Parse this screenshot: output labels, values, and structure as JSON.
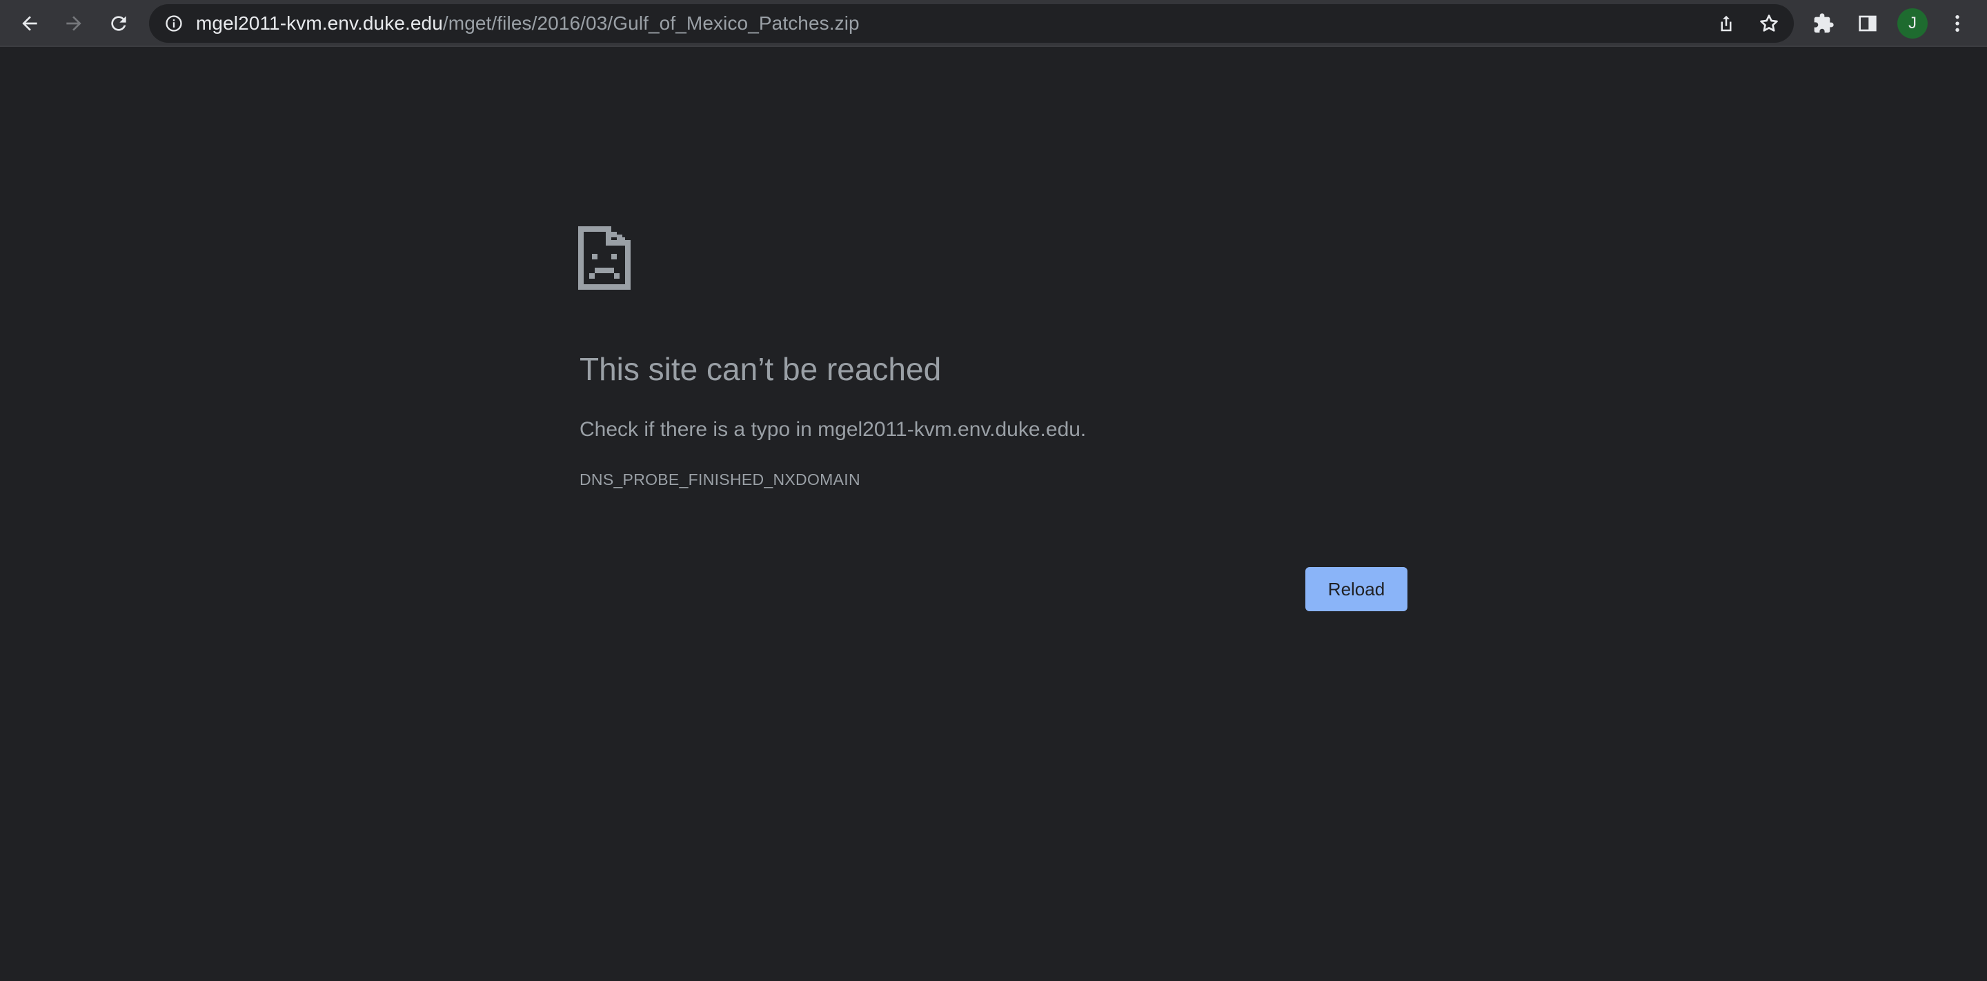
{
  "browser": {
    "nav": {
      "back_icon": "arrow-left-icon",
      "forward_icon": "arrow-right-icon",
      "reload_icon": "reload-icon"
    },
    "omnibox": {
      "info_icon": "info-icon",
      "url_host": "mgel2011-kvm.env.duke.edu",
      "url_path": "/mget/files/2016/03/Gulf_of_Mexico_Patches.zip",
      "share_icon": "share-icon",
      "bookmark_icon": "star-icon"
    },
    "extensions_icon": "puzzle-icon",
    "side_panel_icon": "side-panel-icon",
    "profile_initial": "J",
    "menu_icon": "kebab-menu-icon"
  },
  "colors": {
    "background": "#202124",
    "toolbar": "#35363a",
    "text_secondary": "#9aa0a6",
    "button_blue": "#8ab4f8",
    "avatar_green": "#1e6b2f"
  },
  "error_page": {
    "icon": "sad-document-icon",
    "title": "This site can’t be reached",
    "description": "Check if there is a typo in mgel2011-kvm.env.duke.edu.",
    "error_code": "DNS_PROBE_FINISHED_NXDOMAIN",
    "reload_label": "Reload"
  }
}
